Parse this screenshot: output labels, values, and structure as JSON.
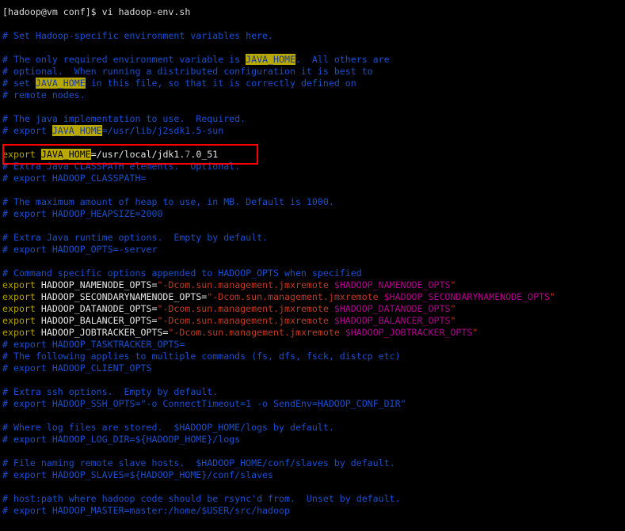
{
  "prompt": "[hadoop@vm conf]$ vi hadoop-env.sh",
  "file": {
    "c1": "# Set Hadoop-specific environment variables here.",
    "c2a": "# The only required environment variable is ",
    "c2b": "JAVA_HOME",
    "c2c": ".  All others are",
    "c3": "# optional.  When running a distributed configuration it is best to",
    "c4a": "# set ",
    "c4b": "JAVA_HOME",
    "c4c": " in this file, so that it is correctly defined on",
    "c5": "# remote nodes.",
    "c6": "# The java implementation to use.  Required.",
    "c7a": "# export ",
    "c7b": "JAVA_HOME",
    "c7c": "=/usr/lib/j2sdk1.5-sun",
    "e1a": "export ",
    "e1b": "JAVA_HOME",
    "e1c": "=/usr/local/jdk1.",
    "e1d": "7",
    "e1e": ".0_51",
    "c8": "# Extra Java CLASSPATH elements.  Optional.",
    "c9": "# export HADOOP_CLASSPATH=",
    "c10": "# The maximum amount of heap to use, in MB. Default is 1000.",
    "c11": "# export HADOOP_HEAPSIZE=2000",
    "c12": "# Extra Java runtime options.  Empty by default.",
    "c13": "# export HADOOP_OPTS=-server",
    "c14": "# Command specific options appended to HADOOP_OPTS when specified",
    "x1a": "export ",
    "x1b": "HADOOP_NAMENODE_OPTS=",
    "x1c": "\"-Dcom.sun.management.jmxremote ",
    "x1d": "$HADOOP_NAMENODE_OPTS",
    "x1e": "\"",
    "x2a": "export ",
    "x2b": "HADOOP_SECONDARYNAMENODE_OPTS=",
    "x2c": "\"-Dcom.sun.management.jmxremote ",
    "x2d": "$HADOOP_SECONDARYNAMENODE_OPTS",
    "x2e": "\"",
    "x3a": "export ",
    "x3b": "HADOOP_DATANODE_OPTS=",
    "x3c": "\"-Dcom.sun.management.jmxremote ",
    "x3d": "$HADOOP_DATANODE_OPTS",
    "x3e": "\"",
    "x4a": "export ",
    "x4b": "HADOOP_BALANCER_OPTS=",
    "x4c": "\"-Dcom.sun.management.jmxremote ",
    "x4d": "$HADOOP_BALANCER_OPTS",
    "x4e": "\"",
    "x5a": "export ",
    "x5b": "HADOOP_JOBTRACKER_OPTS=",
    "x5c": "\"-Dcom.sun.management.jmxremote ",
    "x5d": "$HADOOP_JOBTRACKER_OPTS",
    "x5e": "\"",
    "c15": "# export HADOOP_TASKTRACKER_OPTS=",
    "c16": "# The following applies to multiple commands (fs, dfs, fsck, distcp etc)",
    "c17": "# export HADOOP_CLIENT_OPTS",
    "c18": "# Extra ssh options.  Empty by default.",
    "c19": "# export HADOOP_SSH_OPTS=\"-o ConnectTimeout=1 -o SendEnv=HADOOP_CONF_DIR\"",
    "c20": "# Where log files are stored.  $HADOOP_HOME/logs by default.",
    "c21": "# export HADOOP_LOG_DIR=${HADOOP_HOME}/logs",
    "c22": "# File naming remote slave hosts.  $HADOOP_HOME/conf/slaves by default.",
    "c23": "# export HADOOP_SLAVES=${HADOOP_HOME}/conf/slaves",
    "c24": "# host:path where hadoop code should be rsync'd from.  Unset by default.",
    "c25": "# export HADOOP_MASTER=master:/home/$USER/src/hadoop"
  },
  "colors": {
    "background": "#000000",
    "comment": "#1a4fd0",
    "highlight": "#b8a800",
    "keyword": "#b5a000",
    "string": "#c23b22",
    "variable": "#b4008e",
    "annotation_box": "#ff0000"
  }
}
